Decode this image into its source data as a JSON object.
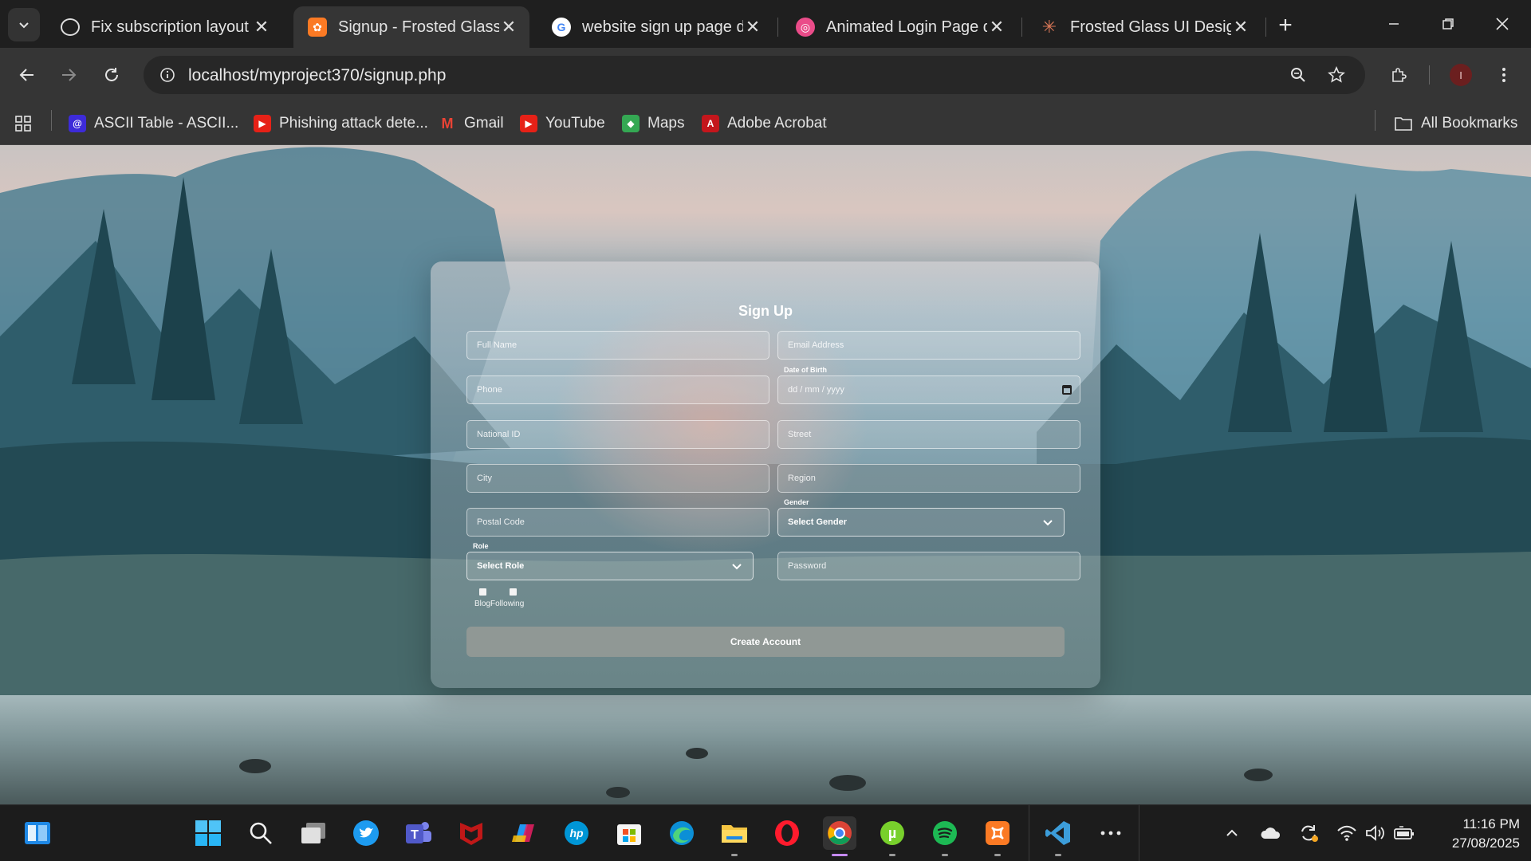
{
  "browser": {
    "tabs": [
      {
        "title": "Fix subscription layout",
        "icon": "chatgpt-icon"
      },
      {
        "title": "Signup - Frosted Glass",
        "icon": "xampp-icon",
        "active": true
      },
      {
        "title": "website sign up page de",
        "icon": "google-icon"
      },
      {
        "title": "Animated Login Page de",
        "icon": "dribbble-icon"
      },
      {
        "title": "Frosted Glass UI Design -",
        "icon": "claude-icon"
      }
    ],
    "url": "localhost/myproject370/signup.php",
    "bookmarks": [
      {
        "label": "ASCII Table - ASCII...",
        "icon": "ascii-icon",
        "color": "#3d2bd9"
      },
      {
        "label": "Phishing attack dete...",
        "icon": "youtube-icon",
        "color": "#e62117"
      },
      {
        "label": "Gmail",
        "icon": "gmail-icon",
        "color": "#d93025"
      },
      {
        "label": "YouTube",
        "icon": "youtube-icon",
        "color": "#e62117"
      },
      {
        "label": "Maps",
        "icon": "maps-icon",
        "color": "#34a853"
      },
      {
        "label": "Adobe Acrobat",
        "icon": "acrobat-icon",
        "color": "#c4161c"
      }
    ],
    "all_bookmarks": "All Bookmarks",
    "profile_initial": "I"
  },
  "form": {
    "title": "Sign Up",
    "full_name_ph": "Full Name",
    "email_ph": "Email Address",
    "phone_ph": "Phone",
    "dob_label": "Date of Birth",
    "dob_ph": "dd / mm / yyyy",
    "national_id_ph": "National ID",
    "street_ph": "Street",
    "city_ph": "City",
    "region_ph": "Region",
    "postal_ph": "Postal Code",
    "gender_label": "Gender",
    "gender_value": "Select Gender",
    "role_label": "Role",
    "role_value": "Select Role",
    "password_ph": "Password",
    "checkbox_text": "BlogFollowing",
    "submit": "Create Account"
  },
  "taskbar": {
    "time": "11:16 PM",
    "date": "27/08/2025"
  },
  "colors": {
    "accent_chrome": "#8ab4f8",
    "xampp": "#fb7a24",
    "spotify": "#1db954",
    "vscode": "#3c9dda"
  }
}
